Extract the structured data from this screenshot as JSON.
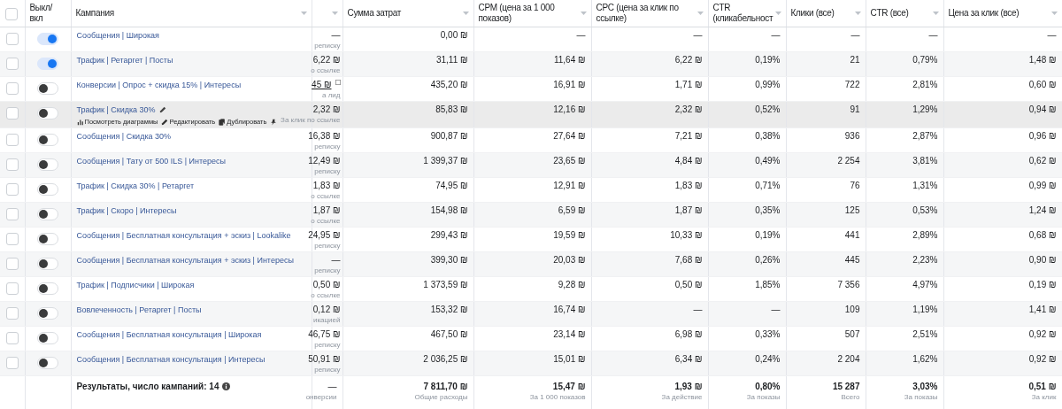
{
  "select_all_checked": false,
  "columns": [
    "Выкл/ вкл",
    "Кампания",
    "Сумма затрат",
    "CPM (цена за 1 000 показов)",
    "CPC (цена за клик по ссылке)",
    "CTR (кликабельност",
    "Клики (все)",
    "CTR (все)",
    "Цена за клик (все)"
  ],
  "rows": [
    {
      "checked": false,
      "name": "Сообщения | Широкая",
      "on": true,
      "hovered": false,
      "cut": "—",
      "cut_sub": "реписку",
      "spend": "0,00 ₪",
      "cpm": "—",
      "cpc": "—",
      "ctr": "—",
      "clicks": "—",
      "ctr_all": "—",
      "cpc_all": "—"
    },
    {
      "checked": false,
      "name": "Трафик | Ретаргет | Посты",
      "on": true,
      "hovered": false,
      "cut": "6,22 ₪",
      "cut_sub": "о ссылке",
      "spend": "31,11 ₪",
      "cpm": "11,64 ₪",
      "cpc": "6,22 ₪",
      "ctr": "0,19%",
      "clicks": "21",
      "ctr_all": "0,79%",
      "cpc_all": "1,48 ₪"
    },
    {
      "checked": false,
      "name": "Конверсии | Опрос + скидка 15% | Интересы",
      "on": false,
      "hovered": false,
      "cut": "45 ₪",
      "cut_note": true,
      "cut_sub": "а лид",
      "spend": "435,20 ₪",
      "cpm": "16,91 ₪",
      "cpc": "1,71 ₪",
      "ctr": "0,99%",
      "clicks": "722",
      "ctr_all": "2,81%",
      "cpc_all": "0,60 ₪"
    },
    {
      "checked": false,
      "name": "Трафик | Скидка 30%",
      "on": false,
      "hovered": true,
      "actions": [
        "Посмотреть диаграммы",
        "Редактировать",
        "Дублировать"
      ],
      "cut": "2,32 ₪",
      "cut_sub": "За клик по ссылке",
      "spend": "85,83 ₪",
      "cpm": "12,16 ₪",
      "cpc": "2,32 ₪",
      "ctr": "0,52%",
      "clicks": "91",
      "ctr_all": "1,29%",
      "cpc_all": "0,94 ₪"
    },
    {
      "checked": false,
      "name": "Сообщения | Скидка 30%",
      "on": false,
      "hovered": false,
      "cut": "16,38 ₪",
      "cut_sub": "реписку",
      "spend": "900,87 ₪",
      "cpm": "27,64 ₪",
      "cpc": "7,21 ₪",
      "ctr": "0,38%",
      "clicks": "936",
      "ctr_all": "2,87%",
      "cpc_all": "0,96 ₪"
    },
    {
      "checked": false,
      "name": "Сообщения | Тату от 500 ILS | Интересы",
      "on": false,
      "hovered": false,
      "cut": "12,49 ₪",
      "cut_sub": "реписку",
      "spend": "1 399,37 ₪",
      "cpm": "23,65 ₪",
      "cpc": "4,84 ₪",
      "ctr": "0,49%",
      "clicks": "2 254",
      "ctr_all": "3,81%",
      "cpc_all": "0,62 ₪"
    },
    {
      "checked": false,
      "name": "Трафик | Скидка 30% | Ретаргет",
      "on": false,
      "hovered": false,
      "cut": "1,83 ₪",
      "cut_sub": "о ссылке",
      "spend": "74,95 ₪",
      "cpm": "12,91 ₪",
      "cpc": "1,83 ₪",
      "ctr": "0,71%",
      "clicks": "76",
      "ctr_all": "1,31%",
      "cpc_all": "0,99 ₪"
    },
    {
      "checked": false,
      "name": "Трафик | Скоро | Интересы",
      "on": false,
      "hovered": false,
      "cut": "1,87 ₪",
      "cut_sub": "о ссылке",
      "spend": "154,98 ₪",
      "cpm": "6,59 ₪",
      "cpc": "1,87 ₪",
      "ctr": "0,35%",
      "clicks": "125",
      "ctr_all": "0,53%",
      "cpc_all": "1,24 ₪"
    },
    {
      "checked": false,
      "name": "Сообщения | Бесплатная консультация + эскиз | Lookalike",
      "on": false,
      "hovered": false,
      "cut": "24,95 ₪",
      "cut_sub": "реписку",
      "spend": "299,43 ₪",
      "cpm": "19,59 ₪",
      "cpc": "10,33 ₪",
      "ctr": "0,19%",
      "clicks": "441",
      "ctr_all": "2,89%",
      "cpc_all": "0,68 ₪"
    },
    {
      "checked": false,
      "name": "Сообщения | Бесплатная консультация + эскиз | Интересы",
      "on": false,
      "hovered": false,
      "cut": "—",
      "cut_sub": "реписку",
      "spend": "399,30 ₪",
      "cpm": "20,03 ₪",
      "cpc": "7,68 ₪",
      "ctr": "0,26%",
      "clicks": "445",
      "ctr_all": "2,23%",
      "cpc_all": "0,90 ₪"
    },
    {
      "checked": false,
      "name": "Трафик | Подписчики | Широкая",
      "on": false,
      "hovered": false,
      "cut": "0,50 ₪",
      "cut_sub": "о ссылке",
      "spend": "1 373,59 ₪",
      "cpm": "9,28 ₪",
      "cpc": "0,50 ₪",
      "ctr": "1,85%",
      "clicks": "7 356",
      "ctr_all": "4,97%",
      "cpc_all": "0,19 ₪"
    },
    {
      "checked": false,
      "name": "Вовлеченность | Ретаргет | Посты",
      "on": false,
      "hovered": false,
      "cut": "0,12 ₪",
      "cut_sub": "икацией",
      "spend": "153,32 ₪",
      "cpm": "16,74 ₪",
      "cpc": "—",
      "ctr": "—",
      "clicks": "109",
      "ctr_all": "1,19%",
      "cpc_all": "1,41 ₪"
    },
    {
      "checked": false,
      "name": "Сообщения | Бесплатная консультация | Широкая",
      "on": false,
      "hovered": false,
      "cut": "46,75 ₪",
      "cut_sub": "реписку",
      "spend": "467,50 ₪",
      "cpm": "23,14 ₪",
      "cpc": "6,98 ₪",
      "ctr": "0,33%",
      "clicks": "507",
      "ctr_all": "2,51%",
      "cpc_all": "0,92 ₪"
    },
    {
      "checked": false,
      "name": "Сообщения | Бесплатная консультация | Интересы",
      "on": false,
      "hovered": false,
      "cut": "50,91 ₪",
      "cut_sub": "реписку",
      "spend": "2 036,25 ₪",
      "cpm": "15,01 ₪",
      "cpc": "6,34 ₪",
      "ctr": "0,24%",
      "clicks": "2 204",
      "ctr_all": "1,62%",
      "cpc_all": "0,92 ₪"
    }
  ],
  "footer": {
    "label": "Результаты, число кампаний: 14",
    "cut": "—",
    "cut_sub": "онверсии",
    "totals": [
      {
        "value": "7 811,70 ₪",
        "sub": "Общие расходы"
      },
      {
        "value": "15,47 ₪",
        "sub": "За 1 000 показов"
      },
      {
        "value": "1,93 ₪",
        "sub": "За действие"
      },
      {
        "value": "0,80%",
        "sub": "За показы"
      },
      {
        "value": "15 287",
        "sub": "Всего"
      },
      {
        "value": "3,03%",
        "sub": "За показы"
      },
      {
        "value": "0,51 ₪",
        "sub": "За клик"
      }
    ]
  }
}
